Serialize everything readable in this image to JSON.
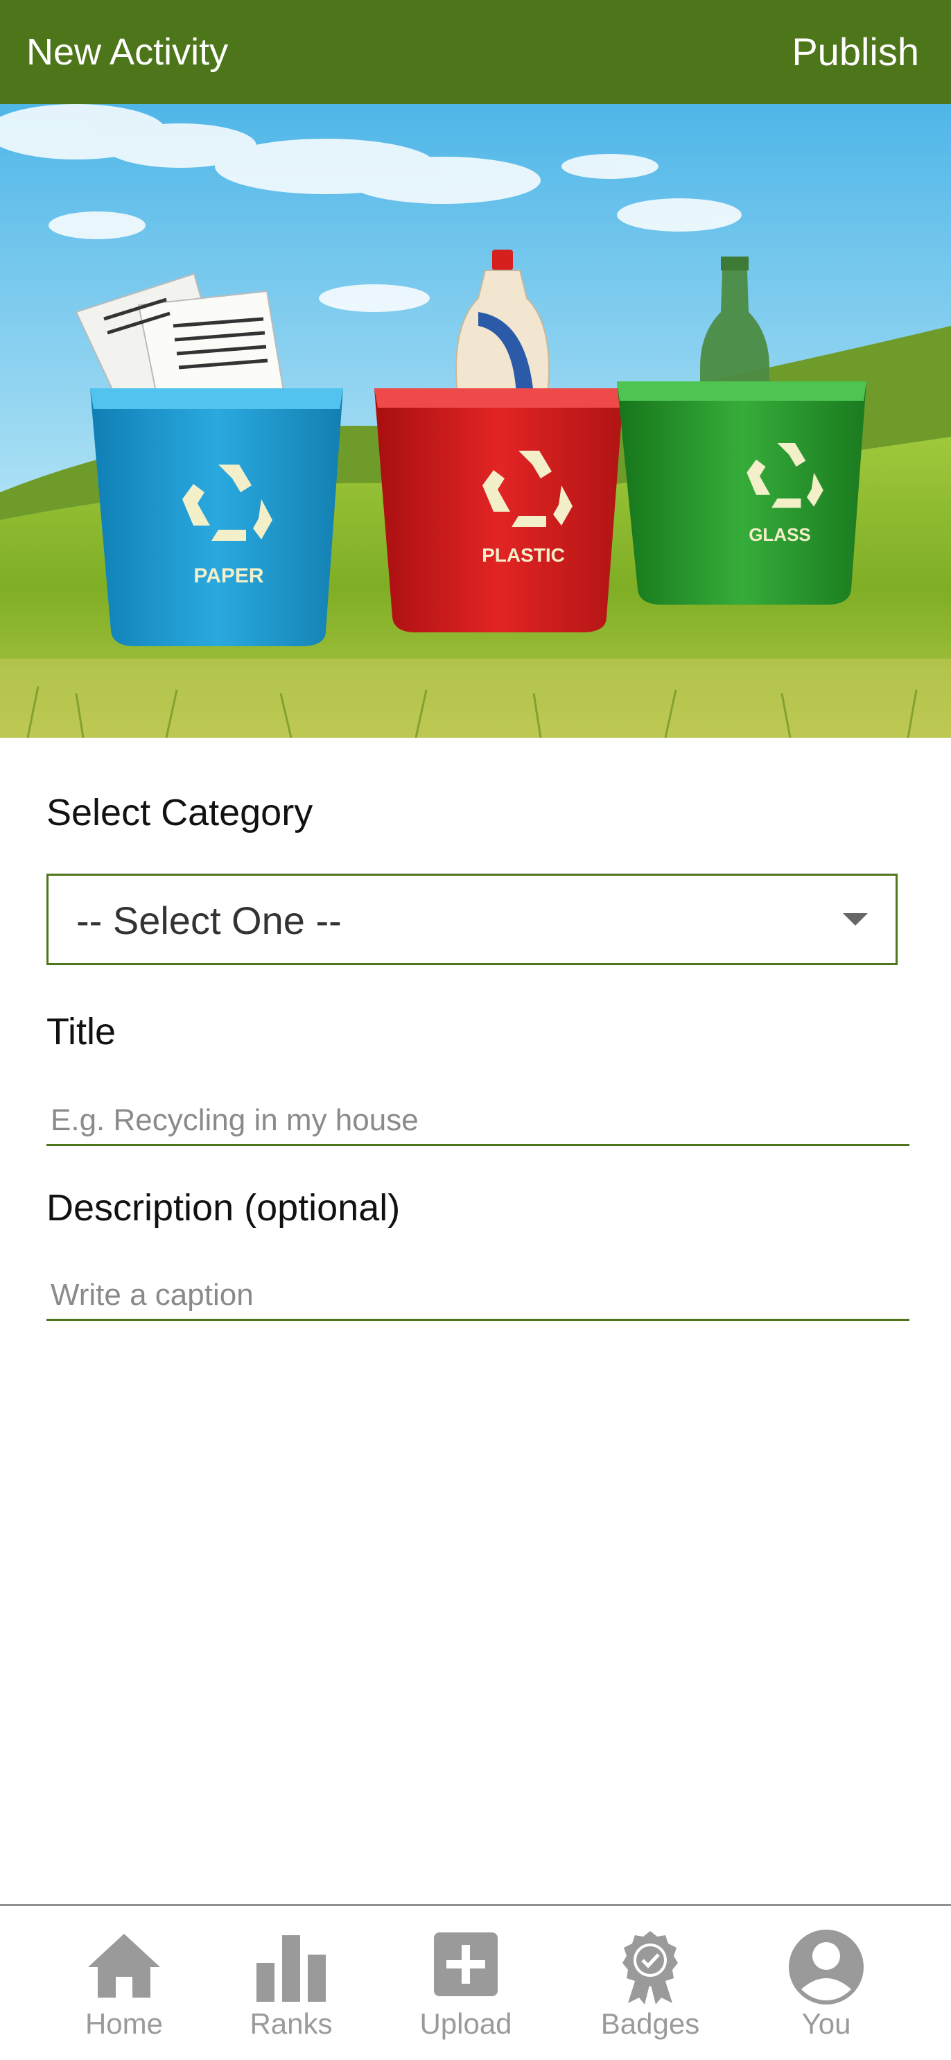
{
  "header": {
    "title": "New Activity",
    "action": "Publish"
  },
  "hero": {
    "bins": [
      {
        "label": "PAPER",
        "color": "#1f9bd0"
      },
      {
        "label": "PLASTIC",
        "color": "#d81d1d"
      },
      {
        "label": "GLASS",
        "color": "#2b9a2f"
      }
    ]
  },
  "form": {
    "category_label": "Select Category",
    "category_value": "-- Select One --",
    "title_label": "Title",
    "title_placeholder": "E.g. Recycling in my house",
    "description_label": "Description (optional)",
    "description_placeholder": "Write a caption"
  },
  "tabbar": {
    "items": [
      {
        "label": "Home",
        "icon": "home-icon"
      },
      {
        "label": "Ranks",
        "icon": "bar-chart-icon"
      },
      {
        "label": "Upload",
        "icon": "plus-square-icon"
      },
      {
        "label": "Badges",
        "icon": "badge-icon"
      },
      {
        "label": "You",
        "icon": "user-icon"
      }
    ]
  },
  "colors": {
    "accent": "#4d7519",
    "tab_inactive": "#9a9a9a"
  }
}
